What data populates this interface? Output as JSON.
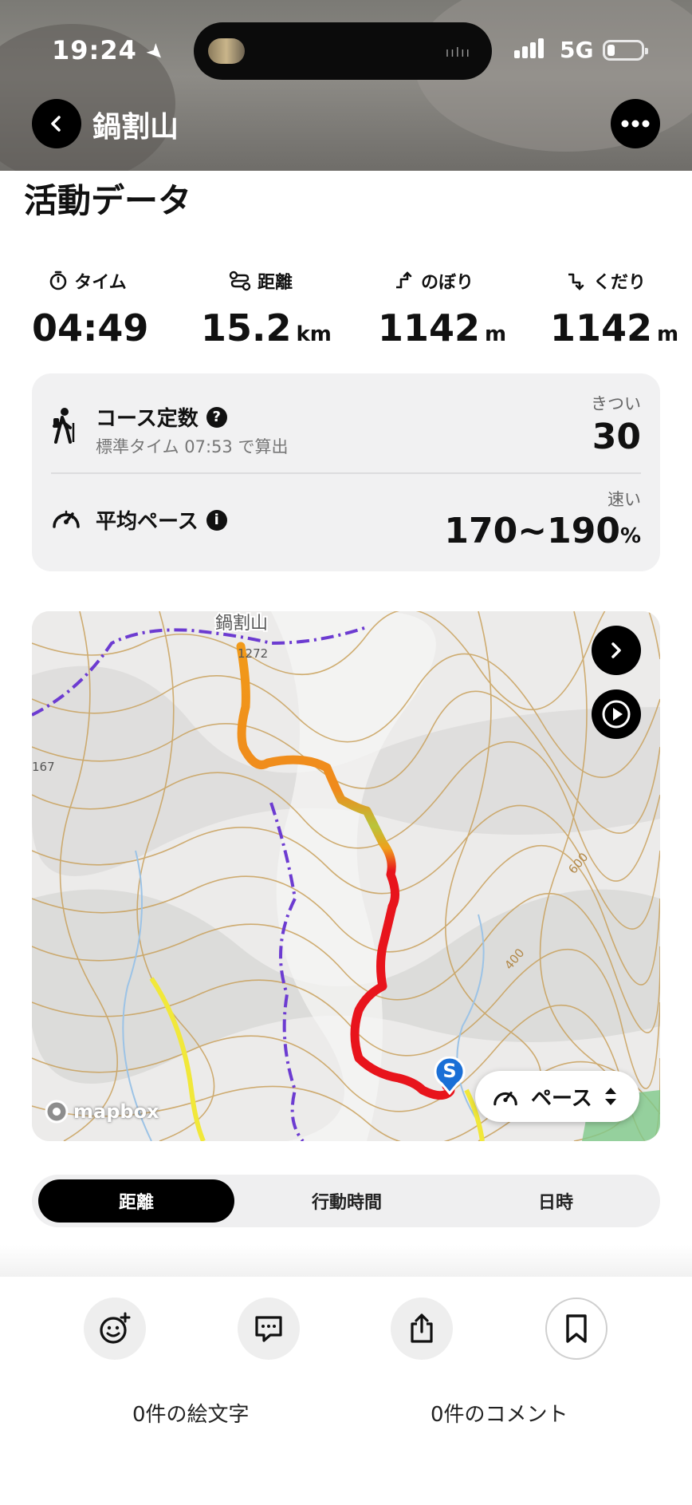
{
  "status_bar": {
    "time": "19:24",
    "network": "5G"
  },
  "header": {
    "title": "鍋割山"
  },
  "section": {
    "title": "活動データ"
  },
  "stats": [
    {
      "label": "タイム",
      "value": "04:49",
      "unit": "",
      "icon": "stopwatch-icon"
    },
    {
      "label": "距離",
      "value": "15.2",
      "unit": "km",
      "icon": "route-icon"
    },
    {
      "label": "のぼり",
      "value": "1142",
      "unit": "m",
      "icon": "ascent-icon"
    },
    {
      "label": "くだり",
      "value": "1142",
      "unit": "m",
      "icon": "descent-icon"
    }
  ],
  "course": {
    "label": "コース定数",
    "sub": "標準タイム 07:53 で算出",
    "rating": "きつい",
    "value": "30"
  },
  "pace": {
    "label": "平均ペース",
    "rating": "速い",
    "value": "170~190",
    "unit": "%"
  },
  "map": {
    "peak_name": "鍋割山",
    "labels": [
      "1272",
      "167",
      "600",
      "400"
    ],
    "attribution": "mapbox",
    "mode_button": "ペース",
    "start_marker": "S"
  },
  "tabs": [
    "距離",
    "行動時間",
    "日時"
  ],
  "active_tab": 0,
  "footer": {
    "emoji_count": "0件の絵文字",
    "comment_count": "0件のコメント"
  },
  "colors": {
    "accent": "#000000",
    "route_hot": "#e8141c",
    "route_warm": "#f08a1c"
  }
}
